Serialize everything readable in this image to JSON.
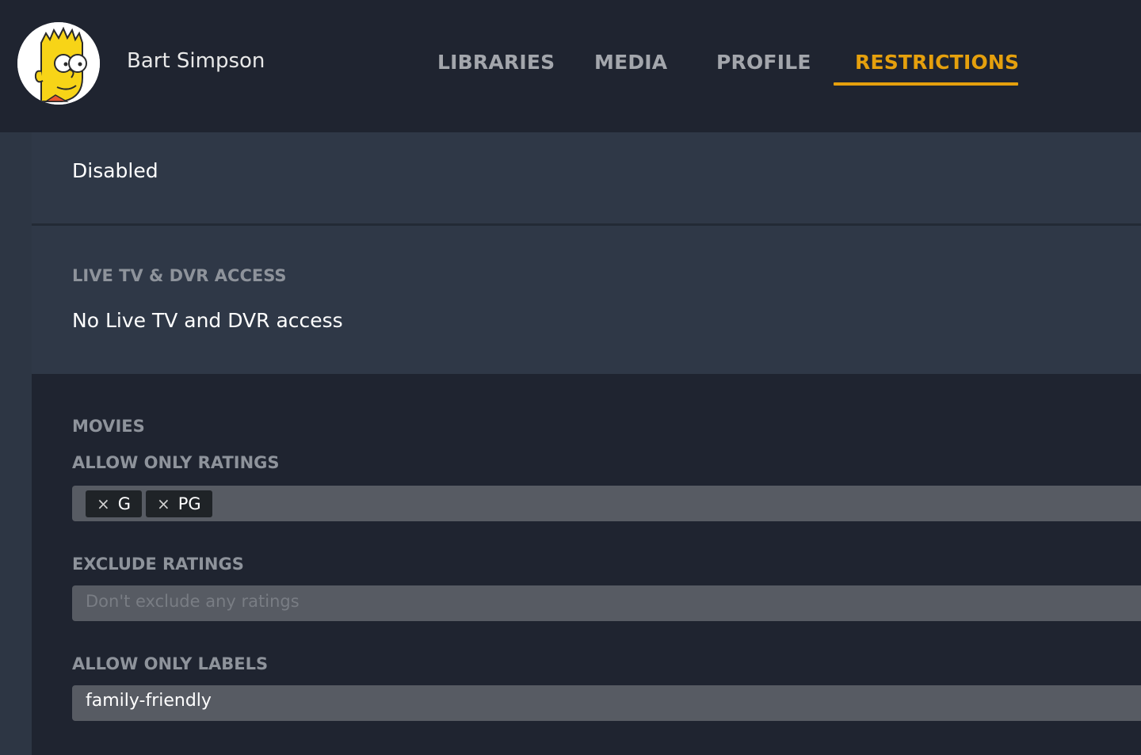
{
  "user": {
    "name": "Bart Simpson"
  },
  "tabs": [
    {
      "label": "LIBRARIES",
      "active": false
    },
    {
      "label": "MEDIA",
      "active": false
    },
    {
      "label": "PROFILE",
      "active": false
    },
    {
      "label": "RESTRICTIONS",
      "active": true
    }
  ],
  "sections": {
    "top_value": "Disabled",
    "live_tv": {
      "label": "LIVE TV & DVR ACCESS",
      "value": "No Live TV and DVR access"
    },
    "movies": {
      "label": "MOVIES",
      "allow_ratings": {
        "label": "ALLOW ONLY RATINGS",
        "chips": [
          "G",
          "PG"
        ],
        "chip_remove_glyph": "×"
      },
      "exclude_ratings": {
        "label": "EXCLUDE RATINGS",
        "placeholder": "Don't exclude any ratings"
      },
      "allow_labels": {
        "label": "ALLOW ONLY LABELS",
        "value": "family-friendly"
      }
    }
  },
  "colors": {
    "accent": "#e5a00d",
    "header_bg": "#1f2430",
    "panel_bg": "#2f3847"
  }
}
